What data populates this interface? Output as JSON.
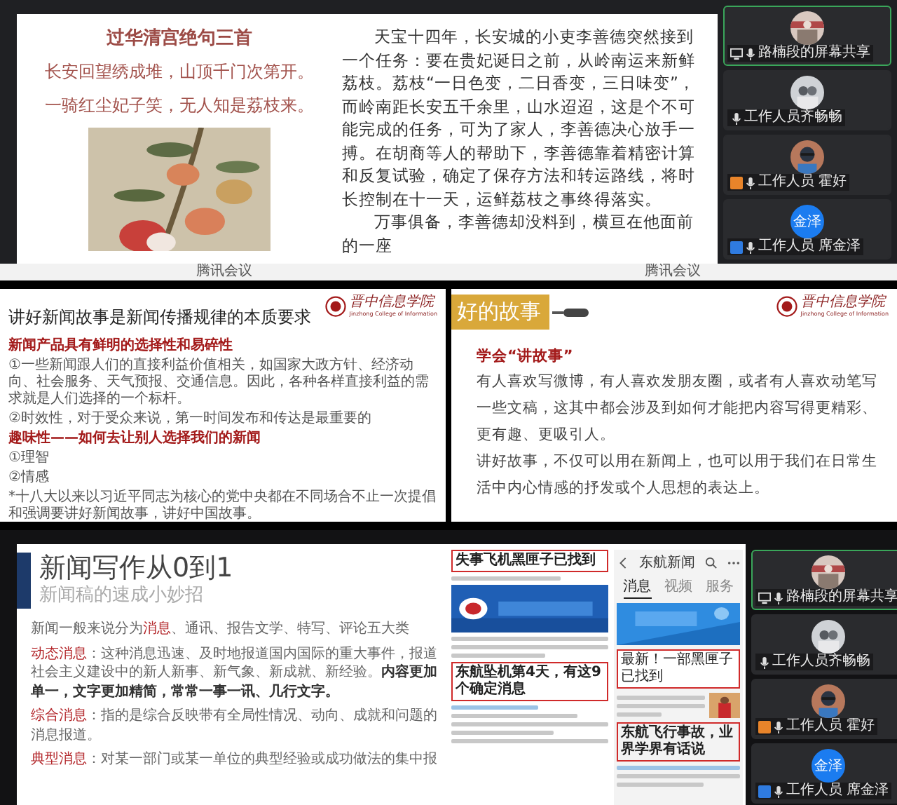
{
  "top_share": {
    "slide": {
      "poem": {
        "title": "过华清宫绝句三首",
        "lines": [
          "长安回望绣成堆，山顶千门次第开。",
          "一骑红尘妃子笑，无人知是荔枝来。"
        ]
      },
      "book_cover": {
        "kind": "picture"
      },
      "paragraphs": [
        "天宝十四年，长安城的小吏李善德突然接到一个任务：要在贵妃诞日之前，从岭南运来新鲜荔枝。荔枝“一日色变，二日香变，三日味变”，而岭南距长安五千余里，山水迢迢，这是个不可能完成的任务，可为了家人，李善德决心放手一搏。在胡商等人的帮助下，李善德靠着精密计算和反复试验，确定了保存方法和转运路线，将时长控制在十一天，运鲜荔枝之事终得落实。",
        "万事俱备，李善德却没料到，横亘在他面前的一座"
      ]
    },
    "footer_labels": [
      "腾讯会议",
      "腾讯会议"
    ],
    "participants": [
      {
        "name": "路楠段的屏幕共享",
        "selected": true,
        "screen_sharing": true,
        "avatar": {
          "kind": "picture"
        }
      },
      {
        "name": "工作人员齐畅畅",
        "selected": false,
        "screen_sharing": false,
        "avatar": {
          "kind": "picture"
        }
      },
      {
        "name": "工作人员 霍好",
        "selected": false,
        "screen_sharing": false,
        "color": "#e8842a",
        "avatar": {
          "kind": "picture"
        }
      },
      {
        "name": "工作人员 席金泽",
        "selected": false,
        "screen_sharing": false,
        "color": "#2f7be0",
        "avatar": {
          "kind": "initials",
          "text": "金泽"
        }
      }
    ]
  },
  "middle_left": {
    "title": "讲好新闻故事是新闻传播规律的本质要求",
    "logo": {
      "name": "晋中信息学院",
      "subtitle": "Jinzhong College of Information"
    },
    "items": [
      {
        "kind": "heading",
        "text": "新闻产品具有鲜明的选择性和易碎性"
      },
      {
        "kind": "body",
        "text": "①一些新闻跟人们的直接利益价值相关，如国家大政方针、经济动向、社会服务、天气预报、交通信息。因此，各种各样直接利益的需求就是人们选择的一个标杆。"
      },
      {
        "kind": "body",
        "text": "②时效性，对于受众来说，第一时间发布和传达是最重要的"
      },
      {
        "kind": "heading",
        "text": "趣味性——如何去让别人选择我们的新闻"
      },
      {
        "kind": "body",
        "text": "①理智"
      },
      {
        "kind": "body",
        "text": "②情感"
      },
      {
        "kind": "body",
        "text": "*十八大以来以习近平同志为核心的党中央都在不同场合不止一次提倡和强调要讲好新闻故事，讲好中国故事。"
      }
    ]
  },
  "middle_right": {
    "banner": "好的故事",
    "logo": {
      "name": "晋中信息学院",
      "subtitle": "Jinzhong College of Information"
    },
    "heading": "学会“讲故事”",
    "paragraphs": [
      "有人喜欢写微博，有人喜欢发朋友圈，或者有人喜欢动笔写一些文稿，这其中都会涉及到如何才能把内容写得更精彩、更有趣、更吸引人。",
      "讲好故事，不仅可以用在新闻上，也可以用于我们在日常生活中内心情感的抒发或个人思想的表达上。"
    ]
  },
  "bottom_left": {
    "title": "新闻写作从0到1",
    "subtitle": "新闻稿的速成小妙招",
    "paragraphs": [
      {
        "segments": [
          {
            "kind": "plain",
            "text": "新闻一般来说分为"
          },
          {
            "kind": "highlight",
            "text": "消息"
          },
          {
            "kind": "plain",
            "text": "、通讯、报告文学、特写、评论五大类"
          }
        ]
      },
      {
        "segments": [
          {
            "kind": "highlight",
            "text": "动态消息"
          },
          {
            "kind": "plain",
            "text": "：这种消息迅速、及时地报道国内国际的重大事件，报道社会主义建设中的新人新事、新气象、新成就、新经验。"
          },
          {
            "kind": "bold",
            "text": "内容更加单一，文字更加精简，常常一事一讯、几行文字。"
          }
        ]
      },
      {
        "segments": [
          {
            "kind": "highlight",
            "text": "综合消息"
          },
          {
            "kind": "plain",
            "text": "：指的是综合反映带有全局性情况、动向、成就和问题的消息报道。"
          }
        ]
      },
      {
        "segments": [
          {
            "kind": "highlight",
            "text": "典型消息"
          },
          {
            "kind": "plain",
            "text": "：对某一部门或某一单位的典型经验或成功做法的集中报"
          }
        ]
      }
    ]
  },
  "bottom_right": {
    "article": {
      "headline": "失事飞机黑匣子已找到",
      "banner": {
        "kind": "picture"
      },
      "subheadline": "东航坠机第4天，有这9个确定消息"
    },
    "phone": {
      "title": "东航新闻",
      "tabs": [
        {
          "label": "消息",
          "selected": true
        },
        {
          "label": "视频",
          "selected": false
        },
        {
          "label": "服务",
          "selected": false
        }
      ],
      "banner": {
        "kind": "picture"
      },
      "banner_caption": "最新！一部黑匣子已找到",
      "story_headline": "东航飞行事故，业界学界有话说"
    },
    "participants": [
      {
        "name": "路楠段的屏幕共享",
        "selected": true,
        "screen_sharing": true,
        "avatar": {
          "kind": "picture"
        }
      },
      {
        "name": "工作人员齐畅畅",
        "selected": false,
        "screen_sharing": false,
        "avatar": {
          "kind": "picture"
        }
      },
      {
        "name": "工作人员 霍好",
        "selected": false,
        "screen_sharing": false,
        "color": "#e8842a",
        "avatar": {
          "kind": "picture"
        }
      },
      {
        "name": "工作人员 席金泽",
        "selected": false,
        "screen_sharing": false,
        "color": "#2f7be0",
        "avatar": {
          "kind": "initials",
          "text": "金泽"
        }
      }
    ]
  }
}
